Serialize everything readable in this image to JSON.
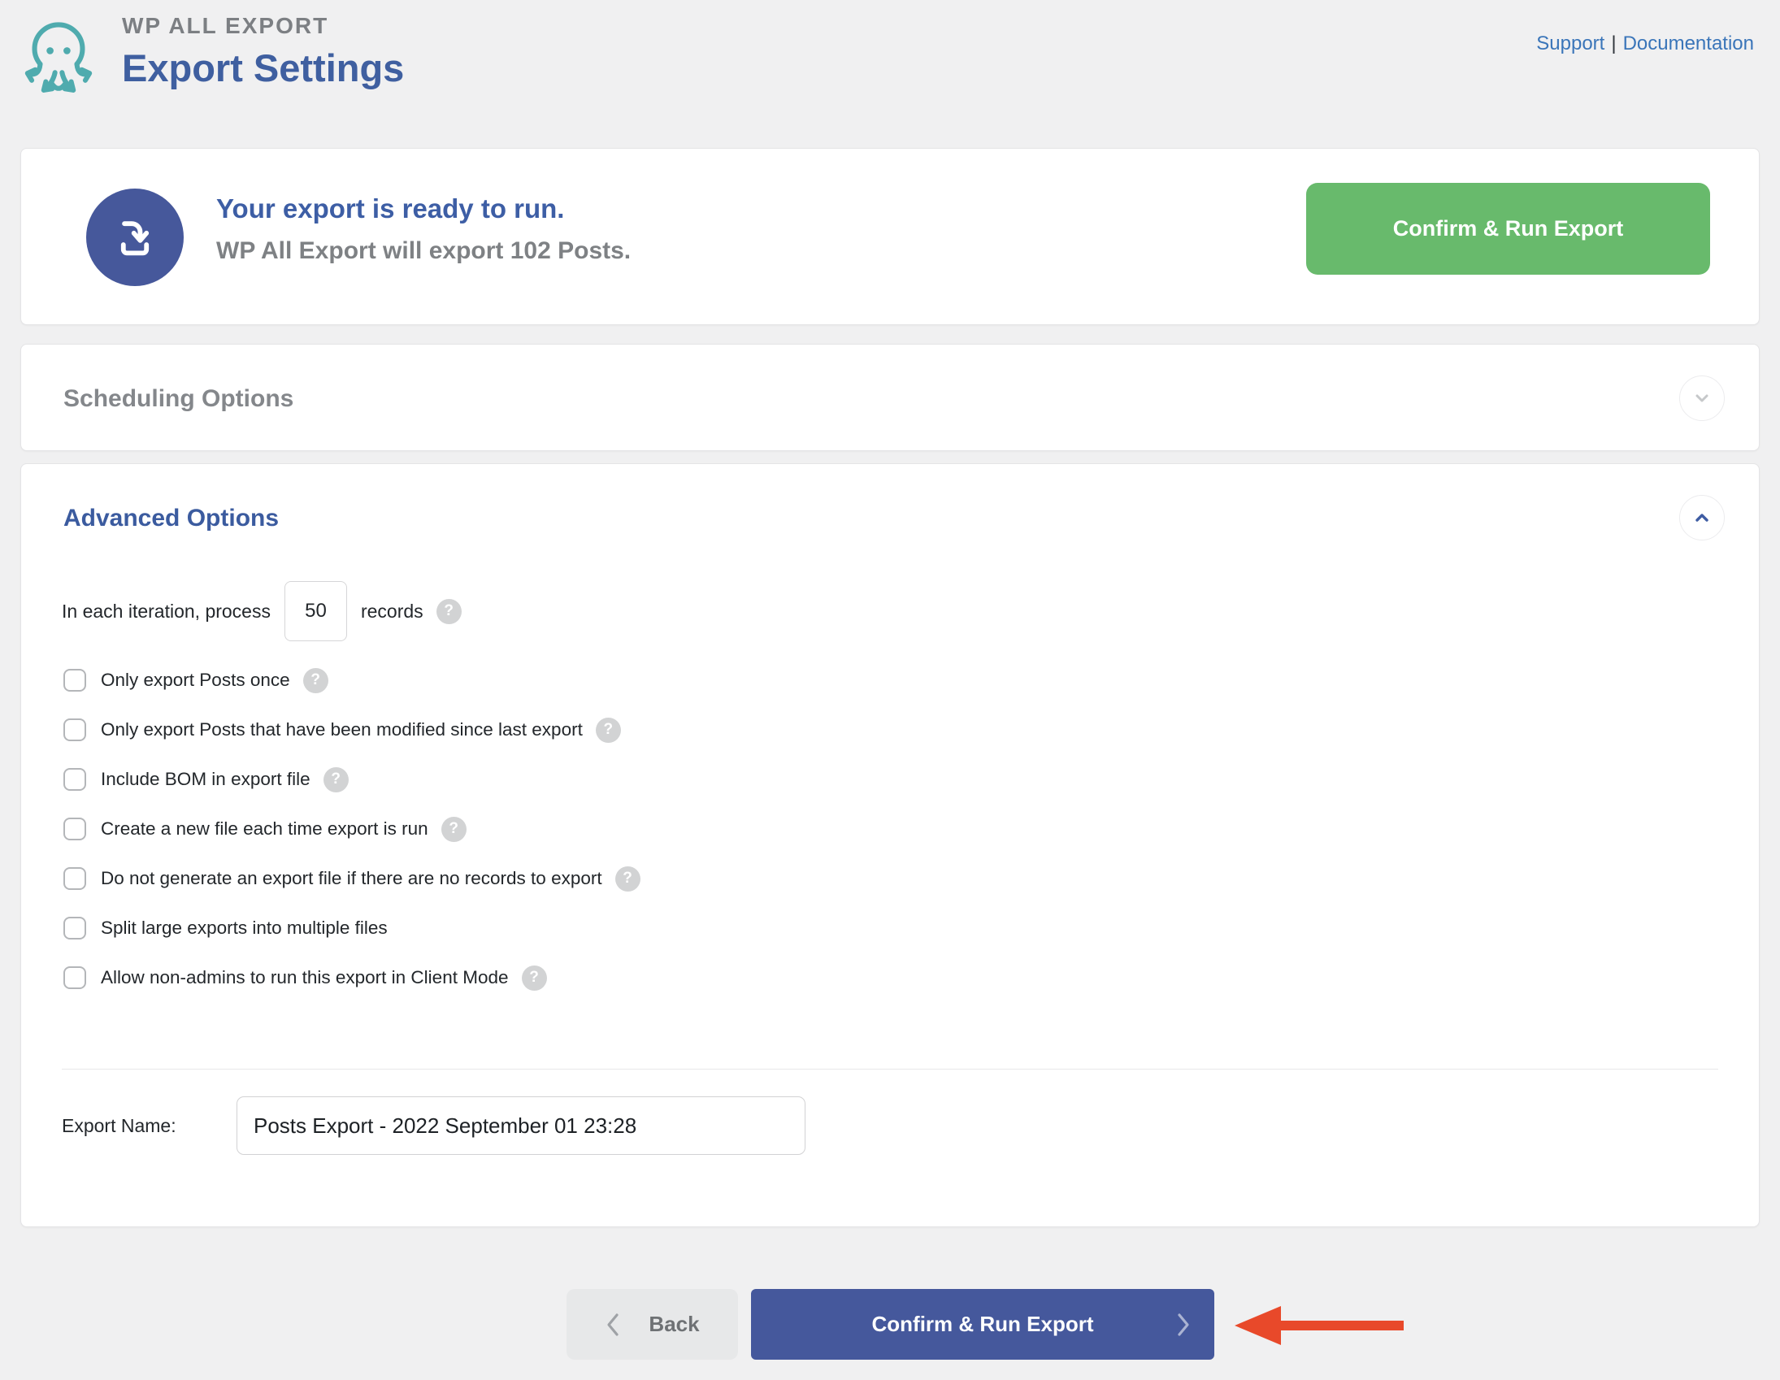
{
  "header": {
    "brand": "WP ALL EXPORT",
    "title": "Export Settings",
    "nav": {
      "support": "Support",
      "separator": "|",
      "documentation": "Documentation"
    }
  },
  "banner": {
    "icon": "download-icon",
    "title": "Your export is ready to run.",
    "subtitle": "WP All Export will export 102 Posts.",
    "confirm_button": "Confirm & Run Export"
  },
  "scheduling": {
    "title": "Scheduling Options",
    "state": "collapsed",
    "icon": "chevron-down-icon"
  },
  "advanced": {
    "title": "Advanced Options",
    "state": "expanded",
    "icon": "chevron-up-icon",
    "iteration": {
      "prefix": "In each iteration, process",
      "value": "50",
      "suffix": "records",
      "help": "?"
    },
    "checkboxes": [
      {
        "label": "Only export Posts once",
        "checked": false,
        "help": true
      },
      {
        "label": "Only export Posts that have been modified since last export",
        "checked": false,
        "help": true
      },
      {
        "label": "Include BOM in export file",
        "checked": false,
        "help": true
      },
      {
        "label": "Create a new file each time export is run",
        "checked": false,
        "help": true
      },
      {
        "label": "Do not generate an export file if there are no records to export",
        "checked": false,
        "help": true
      },
      {
        "label": "Split large exports into multiple files",
        "checked": false,
        "help": false
      },
      {
        "label": "Allow non-admins to run this export in Client Mode",
        "checked": false,
        "help": true
      }
    ],
    "export_name": {
      "label": "Export Name:",
      "value": "Posts Export - 2022 September 01 23:28"
    }
  },
  "footer": {
    "back_button": "Back",
    "confirm_button": "Confirm & Run Export",
    "annotation": "red-arrow-pointing-left"
  },
  "icons": {
    "help_glyph": "?"
  },
  "colors": {
    "page_bg": "#f0f0f1",
    "accent_blue": "#3f5fa0",
    "banner_circle_blue": "#46589b",
    "green_button": "#68ba6c",
    "confirm_blue": "#45589c",
    "link_blue": "#3a75b9",
    "muted_gray": "#7e8184",
    "red_arrow": "#e8492a"
  }
}
